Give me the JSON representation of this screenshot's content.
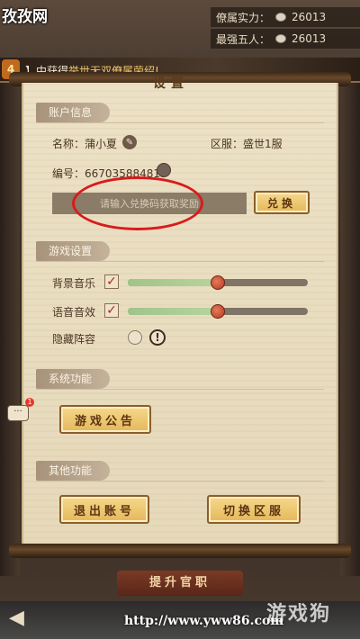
{
  "watermark_top_left": "孜孜网",
  "stats": [
    {
      "label": "僚属实力：",
      "value": "26013"
    },
    {
      "label": "最强五人：",
      "value": "26013"
    }
  ],
  "banner": {
    "badge": "4",
    "text_pre": "】中获得",
    "text_highlight": "举世无双僚属荣绍!",
    "text_post": ""
  },
  "panel": {
    "title": "设置"
  },
  "account": {
    "section_title": "账户信息",
    "name_label": "名称：",
    "name_value": "蒲小夏",
    "server_label": "区服：",
    "server_value": "盛世1服",
    "id_label": "编号：",
    "id_value": "667035884819",
    "code_placeholder": "请输入兑换码获取奖励",
    "redeem_label": "兑换"
  },
  "game_settings": {
    "section_title": "游戏设置",
    "bgm_label": "背景音乐",
    "bgm_level": 0.5,
    "voice_label": "语音音效",
    "voice_level": 0.5,
    "hide_lineup_label": "隐藏阵容",
    "info_icon": "!"
  },
  "system": {
    "section_title": "系统功能",
    "announce_label": "游戏公告"
  },
  "other": {
    "section_title": "其他功能",
    "logout_label": "退出账号",
    "switch_label": "切换区服"
  },
  "chat_badge": "1",
  "promote_label": "提升官职",
  "bottom_url": "http://www.yww86.com",
  "watermark_logo": "游戏狗",
  "colors": {
    "highlight": "#d81b1b",
    "button": "#e5b75a",
    "slider_fill": "#9fc48a"
  }
}
